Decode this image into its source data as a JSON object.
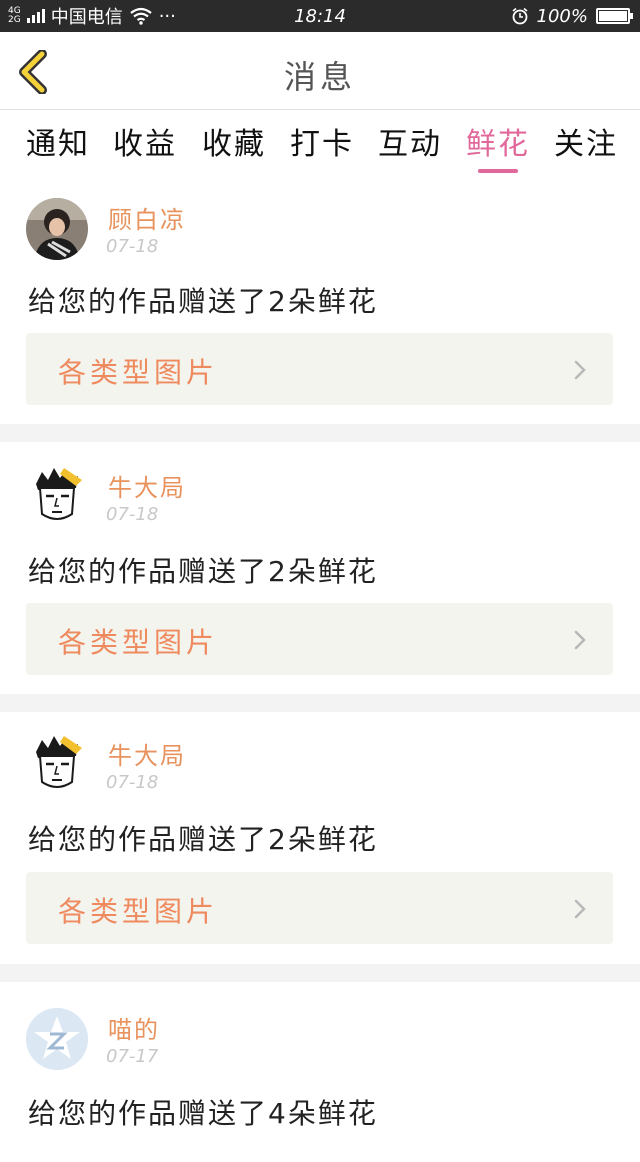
{
  "status_bar": {
    "network_top": "4G",
    "network_bottom": "2G",
    "carrier": "中国电信",
    "more": "···",
    "time": "18:14",
    "battery": "100%",
    "battery_level": 1.0
  },
  "header": {
    "title": "消息"
  },
  "tabs": [
    {
      "label": "通知"
    },
    {
      "label": "收益"
    },
    {
      "label": "收藏"
    },
    {
      "label": "打卡"
    },
    {
      "label": "互动"
    },
    {
      "label": "鲜花",
      "active": true
    },
    {
      "label": "关注"
    }
  ],
  "messages": [
    {
      "user": "顾白凉",
      "date": "07-18",
      "text": "给您的作品赠送了2朵鲜花",
      "link": "各类型图片",
      "avatar": "photo-avatar"
    },
    {
      "user": "牛大局",
      "date": "07-18",
      "text": "给您的作品赠送了2朵鲜花",
      "link": "各类型图片",
      "avatar": "cartoon-face-avatar"
    },
    {
      "user": "牛大局",
      "date": "07-18",
      "text": "给您的作品赠送了2朵鲜花",
      "link": "各类型图片",
      "avatar": "cartoon-face-avatar"
    },
    {
      "user": "喵的",
      "date": "07-17",
      "text": "给您的作品赠送了4朵鲜花",
      "avatar": "default-star-avatar"
    }
  ],
  "colors": {
    "accent_tab": "#e0689a",
    "username": "#e8935e",
    "link_text": "#ee8a5e",
    "back_arrow": "#f5d23a"
  }
}
